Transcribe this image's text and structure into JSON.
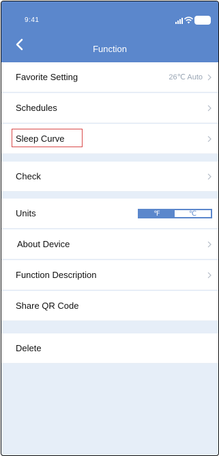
{
  "status_bar": {
    "time": "9:41"
  },
  "header": {
    "title": "Function"
  },
  "menu": {
    "favorite_setting": {
      "label": "Favorite Setting",
      "value": "26℃ Auto"
    },
    "schedules": {
      "label": "Schedules"
    },
    "sleep_curve": {
      "label": "Sleep Curve"
    },
    "check": {
      "label": "Check"
    },
    "units": {
      "label": "Units",
      "options": [
        "℉",
        "℃"
      ],
      "selected": "℃"
    },
    "about_device": {
      "label": "About Device"
    },
    "function_description": {
      "label": "Function Description"
    },
    "share_qr_code": {
      "label": "Share QR Code"
    },
    "delete": {
      "label": "Delete"
    }
  },
  "colors": {
    "header": "#5b87cc",
    "page_background": "#e6eef8",
    "row_background": "#ffffff",
    "highlight": "#d94b4b"
  }
}
